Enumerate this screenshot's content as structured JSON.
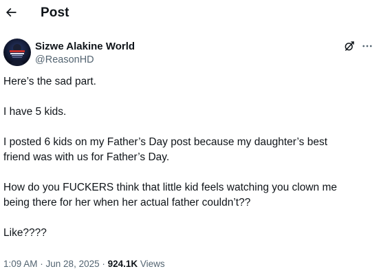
{
  "header": {
    "back_icon": "arrow-left-icon",
    "title": "Post"
  },
  "author": {
    "display_name": "Sizwe Alakine World",
    "handle": "@ReasonHD",
    "avatar_colors": [
      "#0b1020",
      "#1c2b5a",
      "#c9302c"
    ]
  },
  "actions": {
    "grok_icon": "grok-icon",
    "more_icon": "more-dots-icon"
  },
  "tweet": {
    "lines": [
      "Here’s the sad part.",
      "",
      "I have 5 kids.",
      "",
      "I posted 6 kids on my Father’s Day post because my daughter’s best",
      "friend was with us for Father’s Day.",
      "",
      "How do you FUCKERS think that little kid feels watching you clown me",
      "being there for her when her actual father couldn’t??",
      "",
      "Like????"
    ]
  },
  "meta": {
    "time": "1:09 AM",
    "sep1": " · ",
    "date": "Jun 28, 2025",
    "sep2": " · ",
    "views_count": "924.1K",
    "views_label": " Views"
  },
  "colors": {
    "text": "#0f1419",
    "secondary": "#536471",
    "background": "#ffffff"
  }
}
